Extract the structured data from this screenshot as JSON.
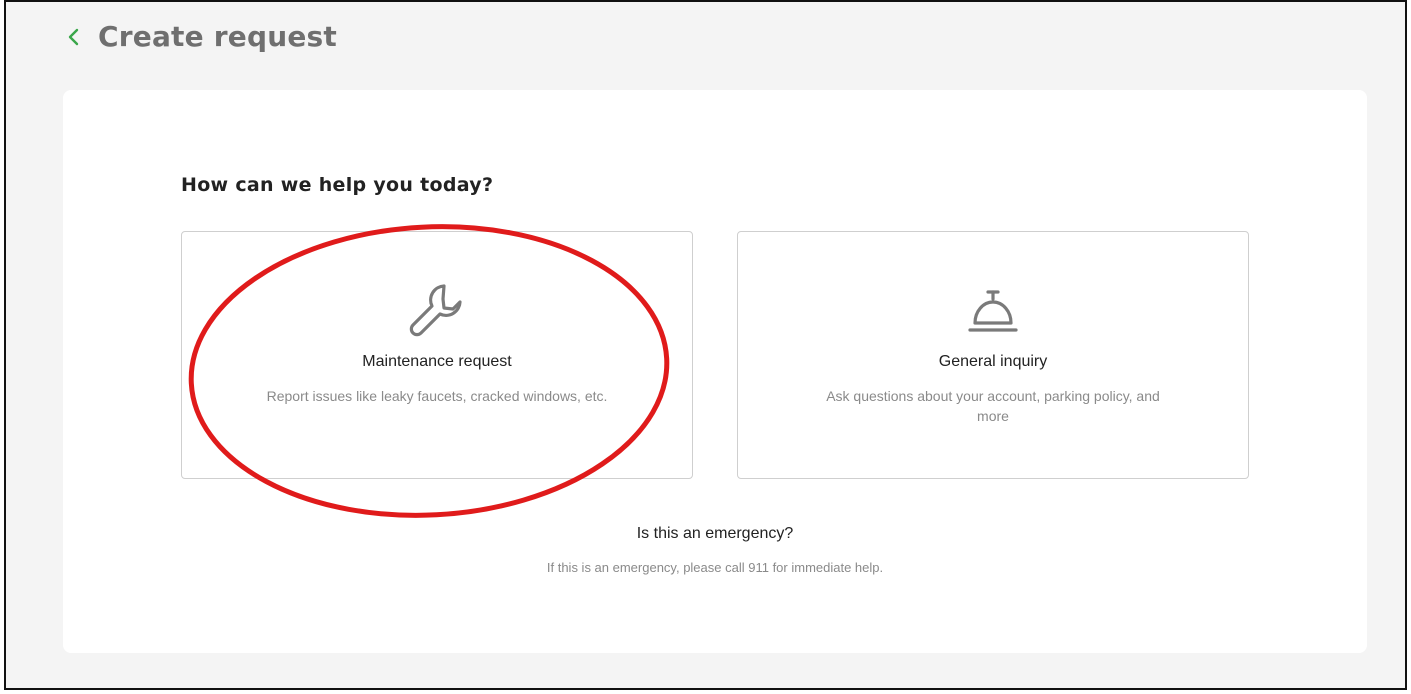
{
  "header": {
    "back_icon": "chevron-left-icon",
    "title": "Create request"
  },
  "main": {
    "question": "How can we help you today?",
    "options": [
      {
        "icon": "wrench-icon",
        "title": "Maintenance request",
        "description": "Report issues like leaky faucets, cracked windows, etc."
      },
      {
        "icon": "service-bell-icon",
        "title": "General inquiry",
        "description": "Ask questions about your account, parking policy, and more"
      }
    ],
    "emergency": {
      "title": "Is this an emergency?",
      "text": "If this is an emergency, please call 911 for immediate help."
    }
  },
  "colors": {
    "accent": "#3aa64a",
    "page_background": "#f4f4f4",
    "annotation": "#e01b1b"
  }
}
